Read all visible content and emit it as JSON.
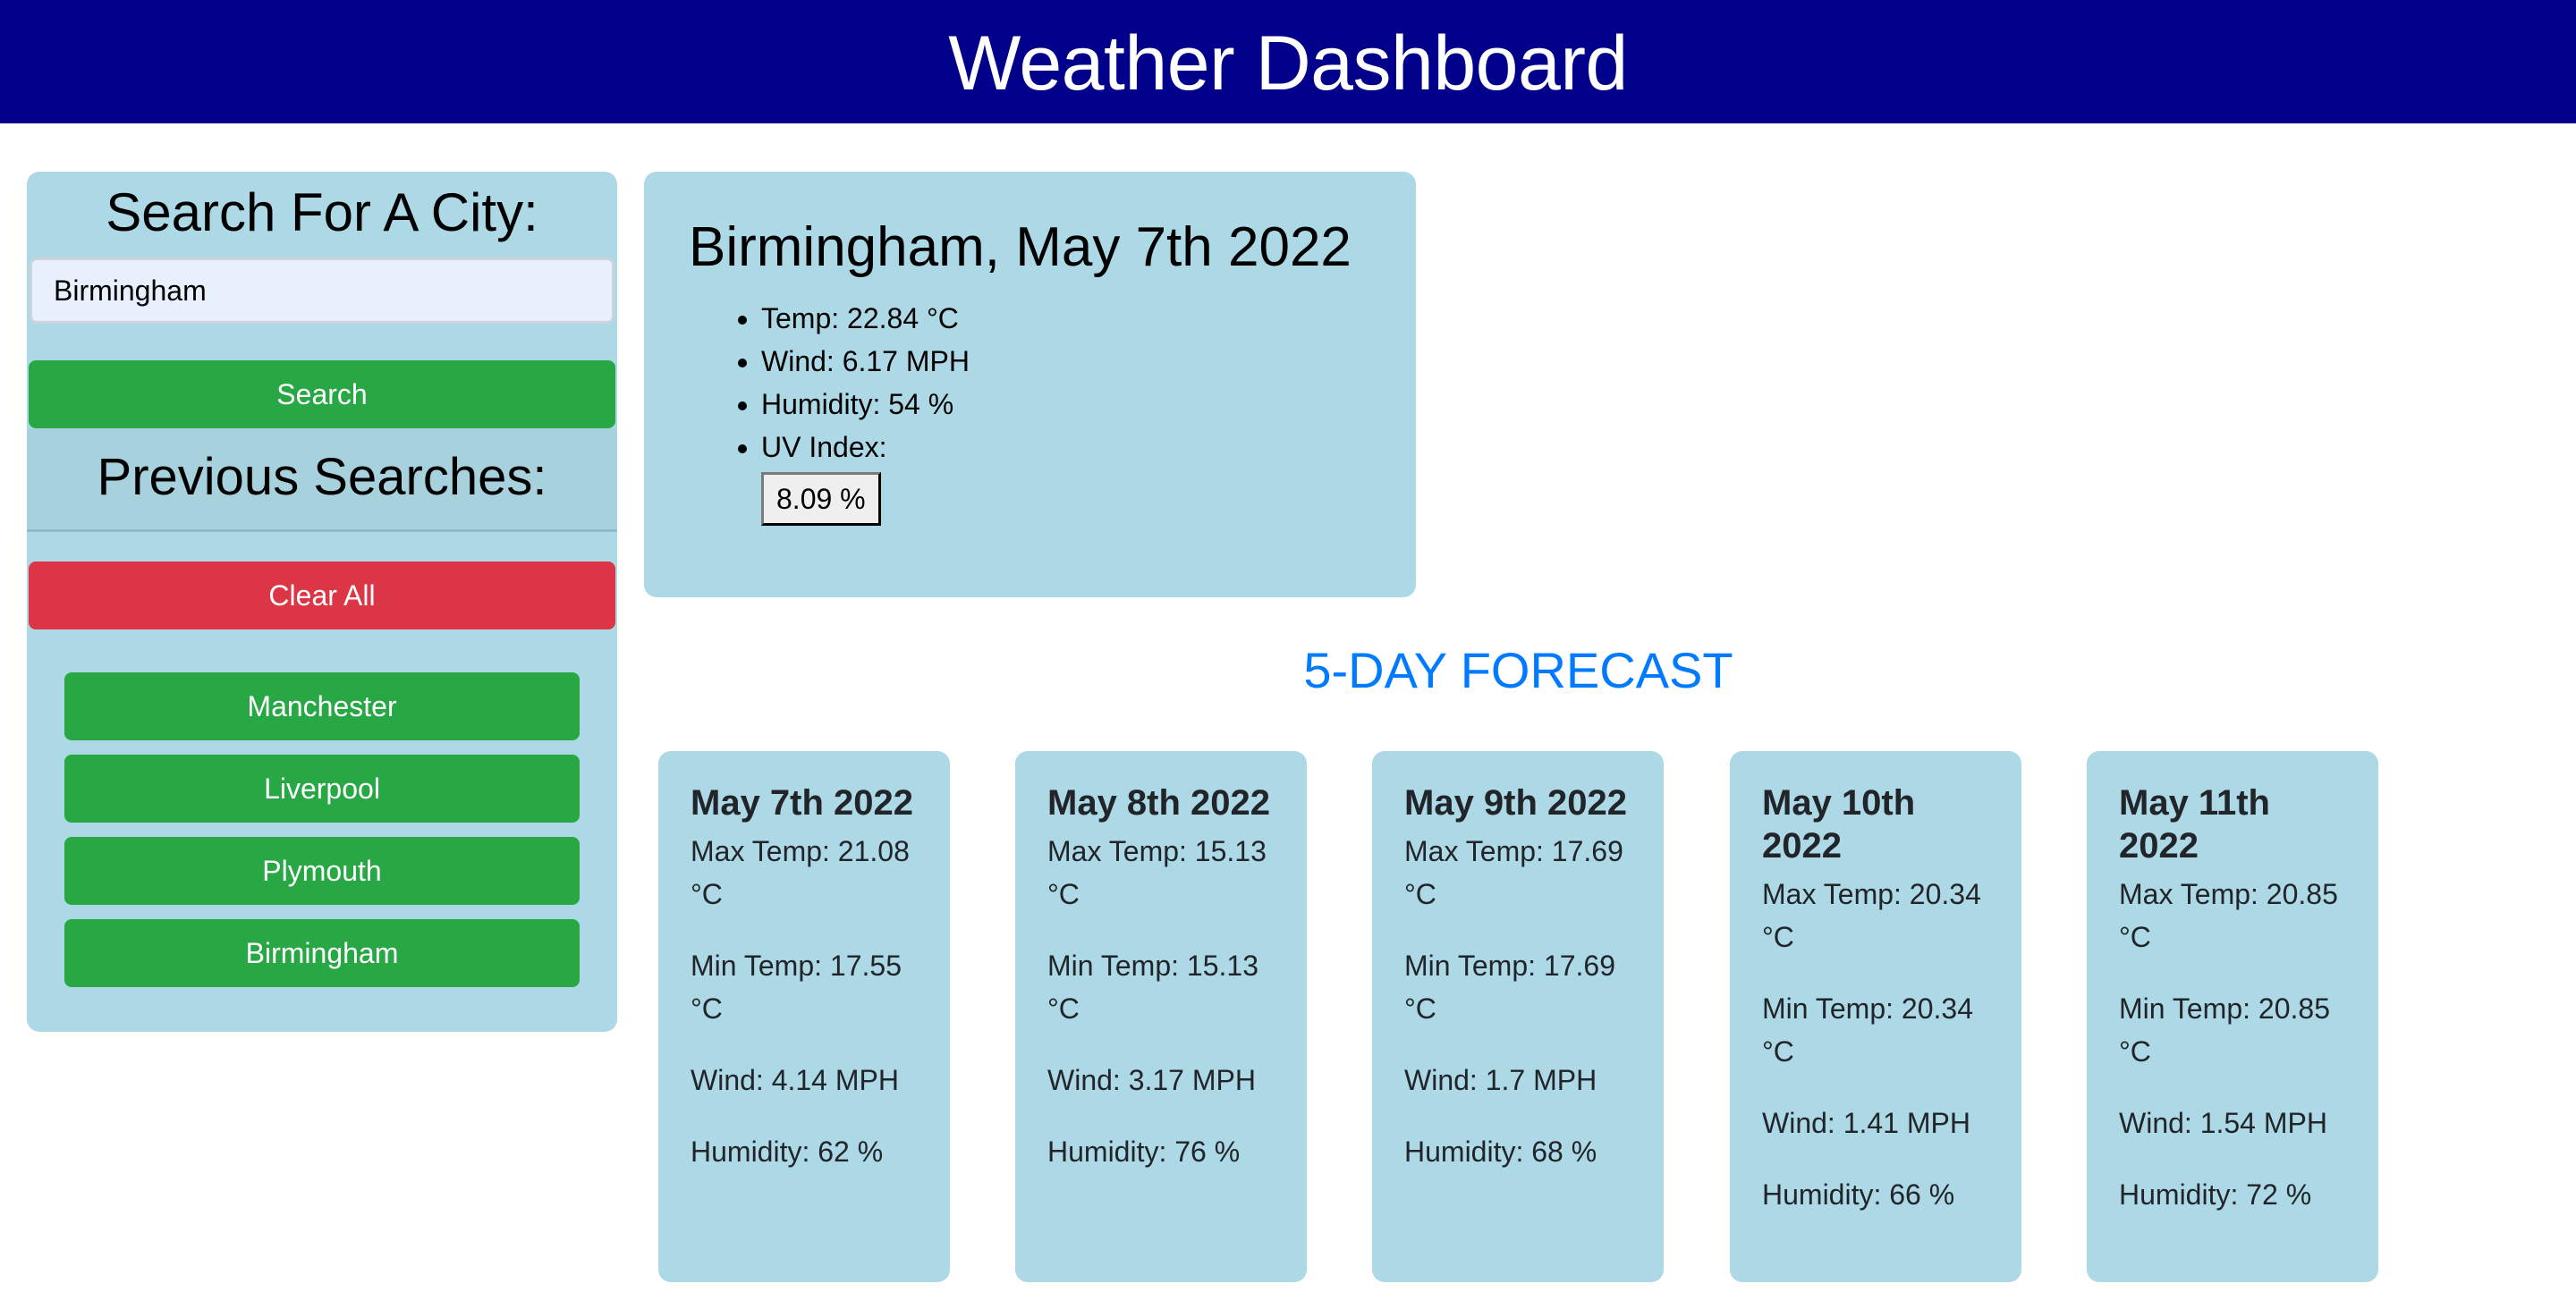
{
  "header": {
    "title": "Weather Dashboard",
    "background_color": "#00008b"
  },
  "sidebar": {
    "title": "Search For A City:",
    "search_input": {
      "value": "Birmingham",
      "placeholder": ""
    },
    "search_button_label": "Search",
    "previous_heading": "Previous Searches:",
    "clear_button_label": "Clear All",
    "previous_searches": [
      {
        "label": "Manchester"
      },
      {
        "label": "Liverpool"
      },
      {
        "label": "Plymouth"
      },
      {
        "label": "Birmingham"
      }
    ]
  },
  "current": {
    "title": "Birmingham, May 7th 2022",
    "temp": "Temp: 22.84 °C",
    "wind": "Wind: 6.17 MPH",
    "humidity": "Humidity: 54 %",
    "uv_label": "UV Index:",
    "uv_value": "8.09 %"
  },
  "forecast": {
    "heading": "5-DAY FORECAST",
    "heading_color": "#007bff",
    "days": [
      {
        "date": "May 7th 2022",
        "max": "Max Temp: 21.08 °C",
        "min": "Min Temp: 17.55 °C",
        "wind": "Wind: 4.14 MPH",
        "humidity": "Humidity: 62 %"
      },
      {
        "date": "May 8th 2022",
        "max": "Max Temp: 15.13 °C",
        "min": "Min Temp: 15.13 °C",
        "wind": "Wind: 3.17 MPH",
        "humidity": "Humidity: 76 %"
      },
      {
        "date": "May 9th 2022",
        "max": "Max Temp: 17.69 °C",
        "min": "Min Temp: 17.69 °C",
        "wind": "Wind: 1.7 MPH",
        "humidity": "Humidity: 68 %"
      },
      {
        "date": "May 10th 2022",
        "max": "Max Temp: 20.34 °C",
        "min": "Min Temp: 20.34 °C",
        "wind": "Wind: 1.41 MPH",
        "humidity": "Humidity: 66 %"
      },
      {
        "date": "May 11th 2022",
        "max": "Max Temp: 20.85 °C",
        "min": "Min Temp: 20.85 °C",
        "wind": "Wind: 1.54 MPH",
        "humidity": "Humidity: 72 %"
      }
    ]
  },
  "colors": {
    "card_background": "#add8e6",
    "button_green": "#28a745",
    "button_red": "#dc3545"
  }
}
